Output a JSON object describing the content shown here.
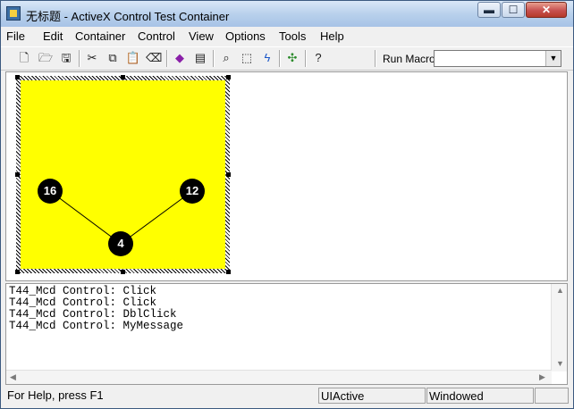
{
  "window": {
    "title": "无标题 - ActiveX Control Test Container",
    "min_glyph": "▬",
    "max_glyph": "☐",
    "close_glyph": "✕"
  },
  "menu": [
    "File",
    "Edit",
    "Container",
    "Control",
    "View",
    "Options",
    "Tools",
    "Help"
  ],
  "toolbar": {
    "run_macro_label": "Run Macro:",
    "run_macro_value": "",
    "buttons": [
      "new-icon",
      "open-icon",
      "save-icon",
      "cut-icon",
      "copy-icon",
      "paste-icon",
      "delete-icon",
      "insert-control-icon",
      "properties-icon",
      "preview-icon",
      "select-icon",
      "lightning-icon",
      "layout-icon",
      "help-icon"
    ]
  },
  "control": {
    "fill_color": "#ffff00",
    "nodes": [
      {
        "label": "16"
      },
      {
        "label": "12"
      },
      {
        "label": "4"
      }
    ]
  },
  "output": {
    "lines": [
      "T44_Mcd Control: Click",
      "T44_Mcd Control: Click",
      "T44_Mcd Control: DblClick",
      "T44_Mcd Control: MyMessage"
    ]
  },
  "status": {
    "help": "For Help, press F1",
    "state": "UIActive",
    "mode": "Windowed"
  }
}
